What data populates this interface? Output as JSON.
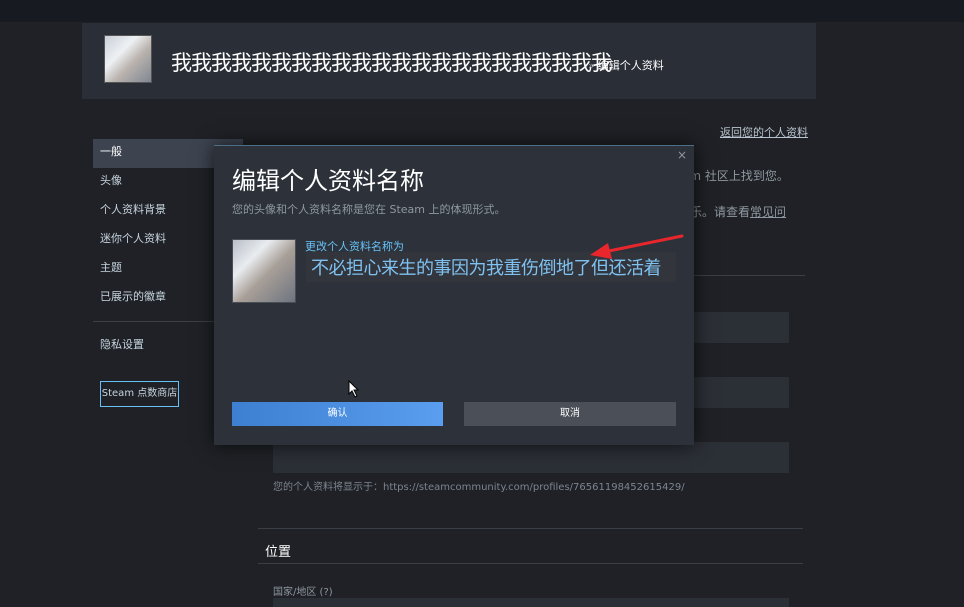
{
  "header": {
    "display_name": "我我我我我我我我我我我我我我我我我我我我我我",
    "breadcrumb_sep": "»",
    "breadcrumb": "编辑个人资料"
  },
  "back_link": "返回您的个人资料",
  "sidebar": {
    "items": [
      {
        "label": "一般"
      },
      {
        "label": "头像"
      },
      {
        "label": "个人资料背景"
      },
      {
        "label": "迷你个人资料"
      },
      {
        "label": "主题"
      },
      {
        "label": "已展示的徽章"
      }
    ],
    "privacy": "隐私设置",
    "store_button": "Steam 点数商店"
  },
  "background": {
    "text1": "am 社区上找到您。",
    "text2a": "乐。请查看",
    "text2b": "常见问",
    "url_text": "您的个人资料将显示于：https://steamcommunity.com/profiles/76561198452615429/",
    "section_location": "位置",
    "country_label": "国家/地区 (?)"
  },
  "modal": {
    "close_glyph": "×",
    "title": "编辑个人资料名称",
    "subtitle": "您的头像和个人资料名称是您在 Steam 上的体现形式。",
    "field_label": "更改个人资料名称为",
    "name_value": "不必担心来生的事因为我重伤倒地了但还活着",
    "confirm_label": "确认",
    "cancel_label": "取消"
  },
  "colors": {
    "accent_blue": "#67c1f5",
    "confirm_blue": "#4a8ee6",
    "arrow_red": "#e8262c"
  }
}
